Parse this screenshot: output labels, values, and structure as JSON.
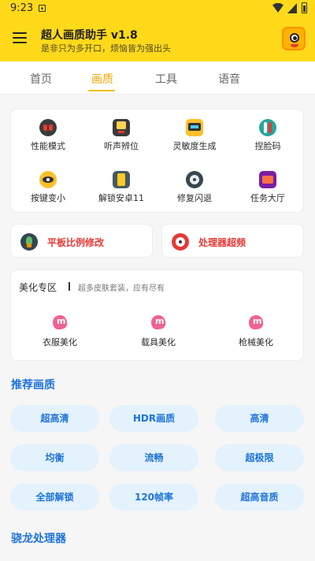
{
  "status_bar": {
    "time": "9:23"
  },
  "header": {
    "title": "超人画质助手 v1.8",
    "subtitle": "是非只为多开口，烦恼皆为强出头"
  },
  "tabs": [
    {
      "label": "首页"
    },
    {
      "label": "画质",
      "active": true
    },
    {
      "label": "工具"
    },
    {
      "label": "语音"
    }
  ],
  "grid": {
    "items": [
      {
        "label": "性能模式",
        "icon": "dual-red-icon"
      },
      {
        "label": "听声辨位",
        "icon": "game-console-icon"
      },
      {
        "label": "灵敏度生成",
        "icon": "tablet-icon"
      },
      {
        "label": "捏脸码",
        "icon": "toggle-icon"
      },
      {
        "label": "按键变小",
        "icon": "eye-icon"
      },
      {
        "label": "解锁安卓11",
        "icon": "phone-icon"
      },
      {
        "label": "修复闪退",
        "icon": "gear-icon"
      },
      {
        "label": "任务大厅",
        "icon": "box-icon"
      }
    ]
  },
  "quick": {
    "left_label": "平板比例修改",
    "right_label": "处理器超频",
    "accent": "#e53935"
  },
  "beauty": {
    "title": "美化专区",
    "desc": "超多皮肤套装，应有尽有",
    "items": [
      {
        "label": "衣服美化"
      },
      {
        "label": "载具美化"
      },
      {
        "label": "枪械美化"
      }
    ]
  },
  "recommend": {
    "title": "推荐画质",
    "options": [
      "超高清",
      "HDR画质",
      "高清",
      "均衡",
      "流畅",
      "超极限",
      "全部解锁",
      "120帧率",
      "超高音质"
    ]
  },
  "snapdragon": {
    "title": "骁龙处理器"
  },
  "colors": {
    "brand": "#ffd91a",
    "accent": "#1e73d8",
    "tab_active": "#f0a800"
  }
}
